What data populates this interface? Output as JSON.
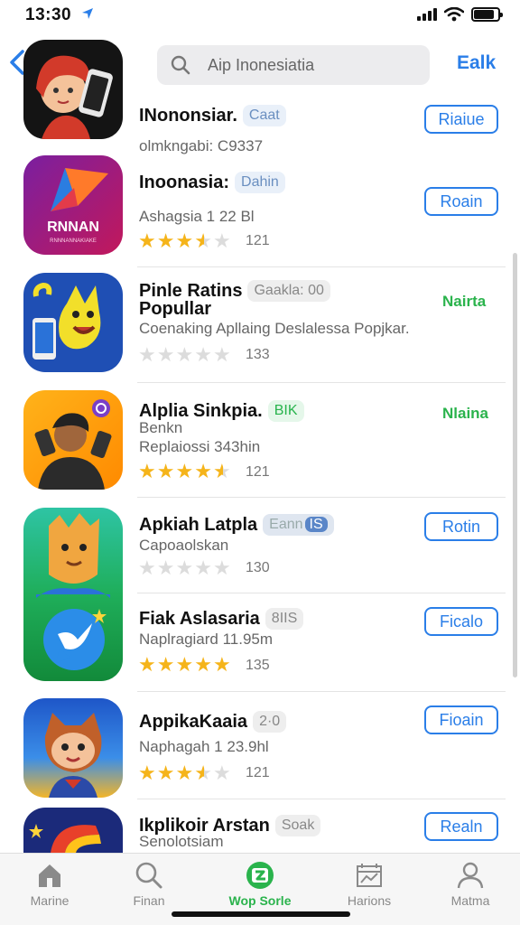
{
  "status": {
    "time": "13:30"
  },
  "header": {
    "search_placeholder": "Aip Inonesiatia",
    "action_label": "Ealk"
  },
  "apps": [
    {
      "title": "INononsiar.",
      "badge": "Caat",
      "subtitle": "olmkngabi: C9337",
      "button": "Riaiue"
    },
    {
      "title": "Inoonasia:",
      "badge": "Dahin",
      "subtitle": "Ashagsia 1 22 Bl",
      "rating": 3.5,
      "count": "121",
      "button": "Roain",
      "icon_text": "RNNAN",
      "icon_subtext": "RNNNANNAKIAKE"
    },
    {
      "title": "Pinle Ratins",
      "title2": "Popullar",
      "badge": "Gaakla: 00",
      "subtitle": "Coenaking Apllaing Deslalessa Popjkar.",
      "rating": 0,
      "count": "133",
      "status": "Nairta"
    },
    {
      "title": "Alplia Sinkpia.",
      "badge": "BIK",
      "subtitle": "Benkn",
      "subtitle2": "Replaiossi 343hin",
      "rating": 4.5,
      "count": "121",
      "status": "Nlaina"
    },
    {
      "title": "Apkiah Latpla",
      "badge": "Eann",
      "badge2": "IS",
      "subtitle": "Capoaolskan",
      "rating": 0,
      "count": "130",
      "button": "Rotin"
    },
    {
      "title": "Fiak Aslasaria",
      "badge": "8IIS",
      "subtitle": "Naplragiard  11.95m",
      "rating": 5,
      "count": "135",
      "button": "Ficalo"
    },
    {
      "title": "AppikaKaaia",
      "badge": "2·0",
      "subtitle": "Naphagah 1 23.9hl",
      "rating": 3.5,
      "count": "121",
      "button": "Fioain"
    },
    {
      "title": "Ikplikoir Arstan",
      "badge": "Soak",
      "subtitle": "Senolotsiam",
      "button": "Realn"
    }
  ],
  "tabs": [
    {
      "label": "Marine",
      "icon": "house-icon"
    },
    {
      "label": "Finan",
      "icon": "search-icon"
    },
    {
      "label": "Wop Sorle",
      "icon": "app-store-icon",
      "active": true
    },
    {
      "label": "Harions",
      "icon": "chart-icon"
    },
    {
      "label": "Matma",
      "icon": "person-icon"
    }
  ],
  "colors": {
    "accent": "#2a7ee8",
    "green": "#2ab34c",
    "star": "#f5b41a"
  }
}
